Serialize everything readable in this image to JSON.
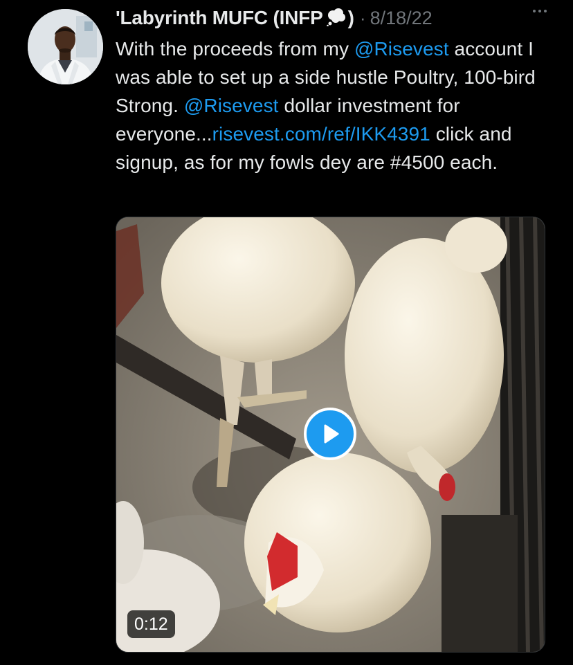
{
  "tweet": {
    "author_name": "'Labyrinth MUFC (INFP",
    "author_name_close": ")",
    "emoji_icon": "thought-balloon-icon",
    "separator": "·",
    "date": "8/18/22",
    "more_icon": "more-horizontal-icon",
    "text_parts": [
      {
        "text": "With the proceeds from my ",
        "link": false
      },
      {
        "text": "@Risevest",
        "link": true
      },
      {
        "text": " account I was able to set up a side hustle Poultry, 100-bird Strong. ",
        "link": false
      },
      {
        "text": "@Risevest",
        "link": true
      },
      {
        "text": " dollar investment for everyone...",
        "link": false
      },
      {
        "text": "risevest.com/ref/IKK4391",
        "link": true
      },
      {
        "text": " click and signup, as for my fowls dey are #4500 each.",
        "link": false
      }
    ],
    "video": {
      "duration": "0:12",
      "play_icon": "play-icon"
    },
    "colors": {
      "background": "#000000",
      "text": "#e7e9ea",
      "muted": "#71767b",
      "link": "#1d9bf0"
    }
  }
}
